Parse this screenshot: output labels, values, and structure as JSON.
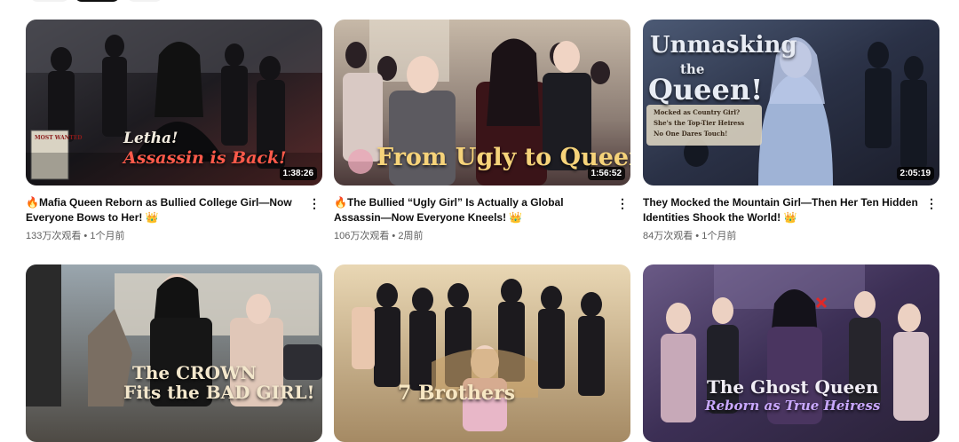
{
  "filter_chips": [
    "",
    "",
    ""
  ],
  "videos": [
    {
      "title": "🔥Mafia Queen Reborn as Bullied College Girl—Now Everyone Bows to Her!",
      "title_emoji_end": "👑",
      "views": "133万次观看",
      "age": "1个月前",
      "sep": " • ",
      "duration": "1:38:26",
      "thumb_text": [
        "Letha!",
        "Assassin is Back!"
      ],
      "thumb_extra": "MOST WANTED"
    },
    {
      "title": "🔥The Bullied “Ugly Girl” Is Actually a Global Assassin—Now Everyone Kneels!",
      "title_emoji_end": "👑",
      "views": "106万次观看",
      "age": "2周前",
      "sep": " • ",
      "duration": "1:56:52",
      "thumb_text": [
        "From Ugly to Queen"
      ]
    },
    {
      "title": "They Mocked the Mountain Girl—Then Her Ten Hidden Identities Shook the World!",
      "title_emoji_end": "👑",
      "views": "84万次观看",
      "age": "1个月前",
      "sep": " • ",
      "duration": "2:05:19",
      "thumb_text": [
        "Unmasking",
        "the",
        "Queen!"
      ],
      "thumb_extra": [
        "Mocked as Country Girl?",
        "She's the Top-Tier Heiress",
        "No One Dares Touch!"
      ]
    },
    {
      "thumb_text": [
        "The CROWN",
        "Fits the BAD GIRL!"
      ]
    },
    {
      "thumb_text": [
        "7 Brothers"
      ]
    },
    {
      "thumb_text": [
        "The Ghost Queen",
        "Reborn as True Heiress"
      ]
    }
  ],
  "icons": {
    "more": "more-vert-icon"
  },
  "colors": {
    "text": "#0f0f0f",
    "meta": "#606060",
    "duration_bg": "#000000cc"
  }
}
